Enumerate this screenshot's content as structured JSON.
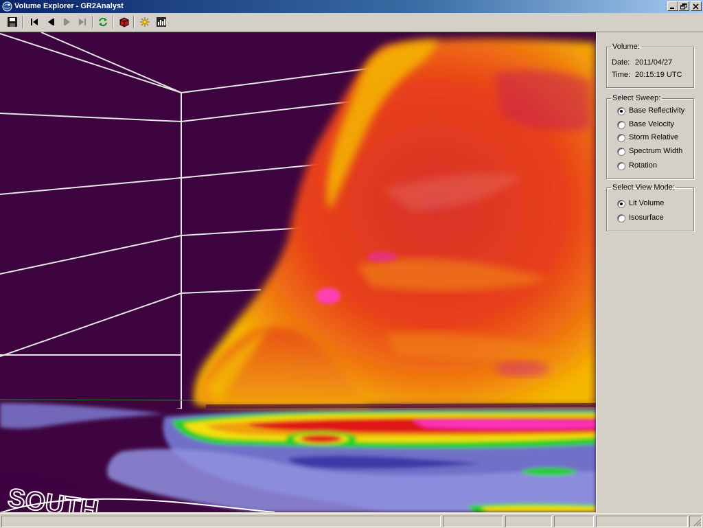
{
  "window": {
    "title": "Volume Explorer - GR2Analyst",
    "minimize_icon": "minimize-icon",
    "restore_icon": "restore-icon",
    "close_icon": "close-icon"
  },
  "toolbar": {
    "buttons": [
      {
        "name": "save-button",
        "icon": "floppy-disk-icon"
      },
      {
        "name": "first-frame-button",
        "icon": "skip-to-start-icon"
      },
      {
        "name": "previous-frame-button",
        "icon": "step-back-icon"
      },
      {
        "name": "next-frame-button",
        "icon": "step-forward-icon"
      },
      {
        "name": "last-frame-button",
        "icon": "skip-to-end-icon"
      },
      {
        "name": "refresh-button",
        "icon": "refresh-icon"
      },
      {
        "name": "volume-cube-button",
        "icon": "cube-icon"
      },
      {
        "name": "lighting-button",
        "icon": "sun-burst-icon"
      },
      {
        "name": "histogram-button",
        "icon": "bar-chart-icon"
      }
    ]
  },
  "viewport": {
    "ground_label": "SOUTH",
    "colors": {
      "background": "#3e0440",
      "storm_core": "#e63010",
      "storm_edge": "#f5b800",
      "grid_lines": "#e6e6e6"
    }
  },
  "panel": {
    "volume": {
      "legend": "Volume:",
      "date_label": "Date:",
      "date_value": "2011/04/27",
      "time_label": "Time:",
      "time_value": "20:15:19 UTC"
    },
    "sweep": {
      "legend": "Select Sweep:",
      "options": [
        "Base Reflectivity",
        "Base Velocity",
        "Storm Relative",
        "Spectrum Width",
        "Rotation"
      ],
      "selected": "Base Reflectivity"
    },
    "view_mode": {
      "legend": "Select View Mode:",
      "options": [
        "Lit Volume",
        "Isosurface"
      ],
      "selected": "Lit Volume"
    }
  },
  "statusbar": {
    "panels": [
      "",
      "",
      "",
      "",
      "",
      ""
    ]
  }
}
